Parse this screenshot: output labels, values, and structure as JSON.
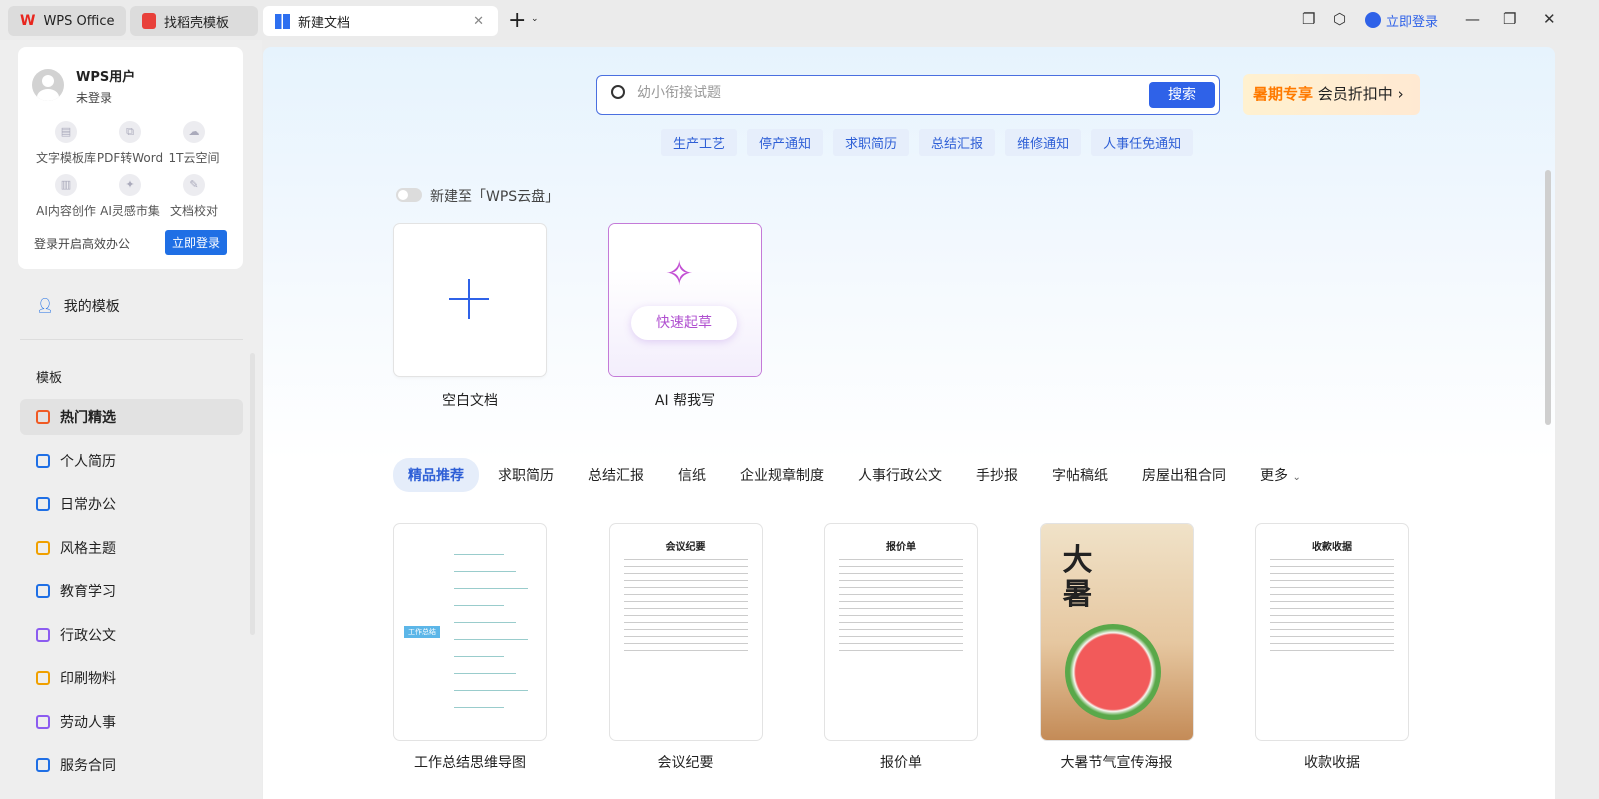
{
  "tabs": [
    {
      "label": "WPS Office"
    },
    {
      "label": "找稻壳模板"
    },
    {
      "label": "新建文档"
    }
  ],
  "titlebar": {
    "login": "立即登录"
  },
  "user": {
    "name": "WPS用户",
    "status": "未登录",
    "prompt": "登录开启高效办公",
    "login_button": "立即登录"
  },
  "features": [
    {
      "label": "文字模板库"
    },
    {
      "label": "PDF转Word"
    },
    {
      "label": "1T云空间"
    },
    {
      "label": "AI内容创作"
    },
    {
      "label": "AI灵感市集"
    },
    {
      "label": "文档校对"
    }
  ],
  "my_templates": "我的模板",
  "section_label": "模板",
  "nav": [
    {
      "label": "热门精选",
      "color": "#f05a24"
    },
    {
      "label": "个人简历",
      "color": "#1f6fe5"
    },
    {
      "label": "日常办公",
      "color": "#1f6fe5"
    },
    {
      "label": "风格主题",
      "color": "#f0a000"
    },
    {
      "label": "教育学习",
      "color": "#1f6fe5"
    },
    {
      "label": "行政公文",
      "color": "#8c5cf0"
    },
    {
      "label": "印刷物料",
      "color": "#f0a000"
    },
    {
      "label": "劳动人事",
      "color": "#8c5cf0"
    },
    {
      "label": "服务合同",
      "color": "#1f6fe5"
    }
  ],
  "search": {
    "placeholder": "幼小衔接试题",
    "button": "搜索"
  },
  "promo": {
    "highlight": "暑期专享",
    "text": "会员折扣中 ›"
  },
  "quick_tags": [
    "生产工艺",
    "停产通知",
    "求职简历",
    "总结汇报",
    "维修通知",
    "人事任免通知"
  ],
  "cloud_toggle": "新建至「WPS云盘」",
  "new_cards": {
    "blank": "空白文档",
    "ai": "AI 帮我写",
    "ai_button": "快速起草"
  },
  "categories": [
    "精品推荐",
    "求职简历",
    "总结汇报",
    "信纸",
    "企业规章制度",
    "人事行政公文",
    "手抄报",
    "字帖稿纸",
    "房屋出租合同",
    "更多"
  ],
  "templates": [
    {
      "title": "工作总结思维导图",
      "thumb": "工作总结"
    },
    {
      "title": "会议纪要",
      "thumb": "会议纪要"
    },
    {
      "title": "报价单",
      "thumb": "报价单"
    },
    {
      "title": "大暑节气宣传海报",
      "thumb": "大暑"
    },
    {
      "title": "收款收据",
      "thumb": "收款收据"
    }
  ]
}
